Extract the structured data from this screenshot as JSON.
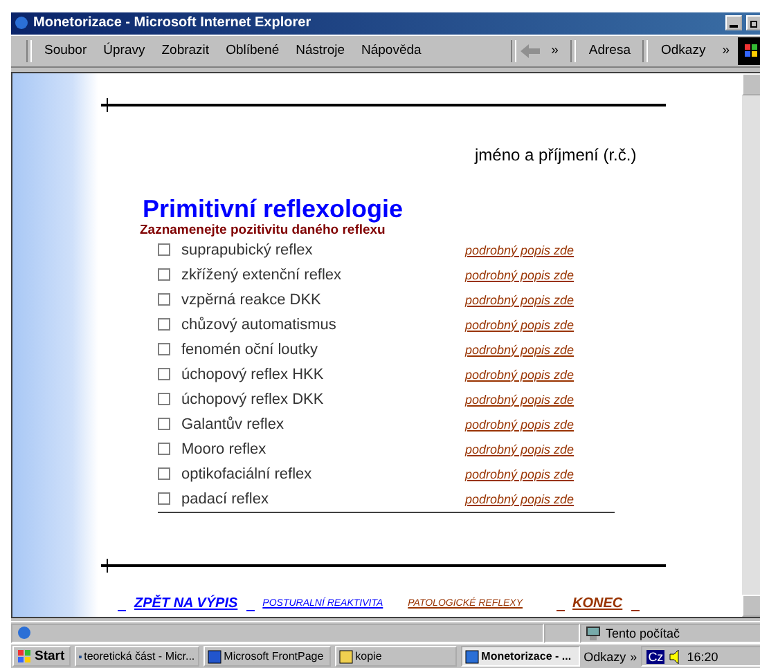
{
  "window": {
    "title": "Monetorizace - Microsoft Internet Explorer"
  },
  "menu": [
    "Soubor",
    "Úpravy",
    "Zobrazit",
    "Oblíbené",
    "Nástroje",
    "Nápověda"
  ],
  "toolbar": {
    "address_label": "Adresa",
    "links_label": "Odkazy",
    "chevron": "»"
  },
  "page": {
    "name_label": "jméno a příjmení (r.č.)",
    "heading": "Primitivní reflexologie",
    "subtitle": "Zaznamenejte pozitivitu daného reflexu",
    "reflexes": [
      {
        "label": "suprapubický reflex",
        "checked": false,
        "link": "podrobný popis zde"
      },
      {
        "label": "zkřížený extenční reflex",
        "checked": false,
        "link": "podrobný popis zde"
      },
      {
        "label": "vzpěrná reakce DKK",
        "checked": false,
        "link": "podrobný popis zde"
      },
      {
        "label": "chůzový automatismus",
        "checked": false,
        "link": "podrobný popis zde"
      },
      {
        "label": "fenomén oční loutky",
        "checked": false,
        "link": "podrobný popis zde"
      },
      {
        "label": "úchopový reflex HKK",
        "checked": false,
        "link": "podrobný popis zde"
      },
      {
        "label": "úchopový reflex DKK",
        "checked": false,
        "link": "podrobný popis zde"
      },
      {
        "label": "Galantův reflex",
        "checked": false,
        "link": "podrobný popis zde"
      },
      {
        "label": "Mooro reflex",
        "checked": false,
        "link": "podrobný popis zde"
      },
      {
        "label": "optikofaciální reflex",
        "checked": false,
        "link": "podrobný popis zde"
      },
      {
        "label": "padací reflex",
        "checked": false,
        "link": "podrobný popis zde"
      }
    ],
    "footer_links": [
      {
        "label": "ZPĚT NA VÝPIS",
        "kind": "major",
        "color": "#0000ff"
      },
      {
        "label": "POSTURALNÍ REAKTIVITA",
        "kind": "minor",
        "color": "#0000ff"
      },
      {
        "label": "PATOLOGICKÉ REFLEXY",
        "kind": "minor",
        "color": "#993300"
      },
      {
        "label": "KONEC",
        "kind": "major",
        "color": "#993300"
      }
    ]
  },
  "status_bar": {
    "zone": "Tento počítač"
  },
  "taskbar": {
    "start": "Start",
    "tasks": [
      {
        "label": "teoretická část - Micr...",
        "selected": false
      },
      {
        "label": "Microsoft FrontPage",
        "selected": false
      },
      {
        "label": "kopie",
        "selected": false
      },
      {
        "label": "Monetorizace - ...",
        "selected": true
      }
    ],
    "links_label": "Odkazy",
    "chevron": "»",
    "language": "Cz",
    "clock": "16:20"
  }
}
